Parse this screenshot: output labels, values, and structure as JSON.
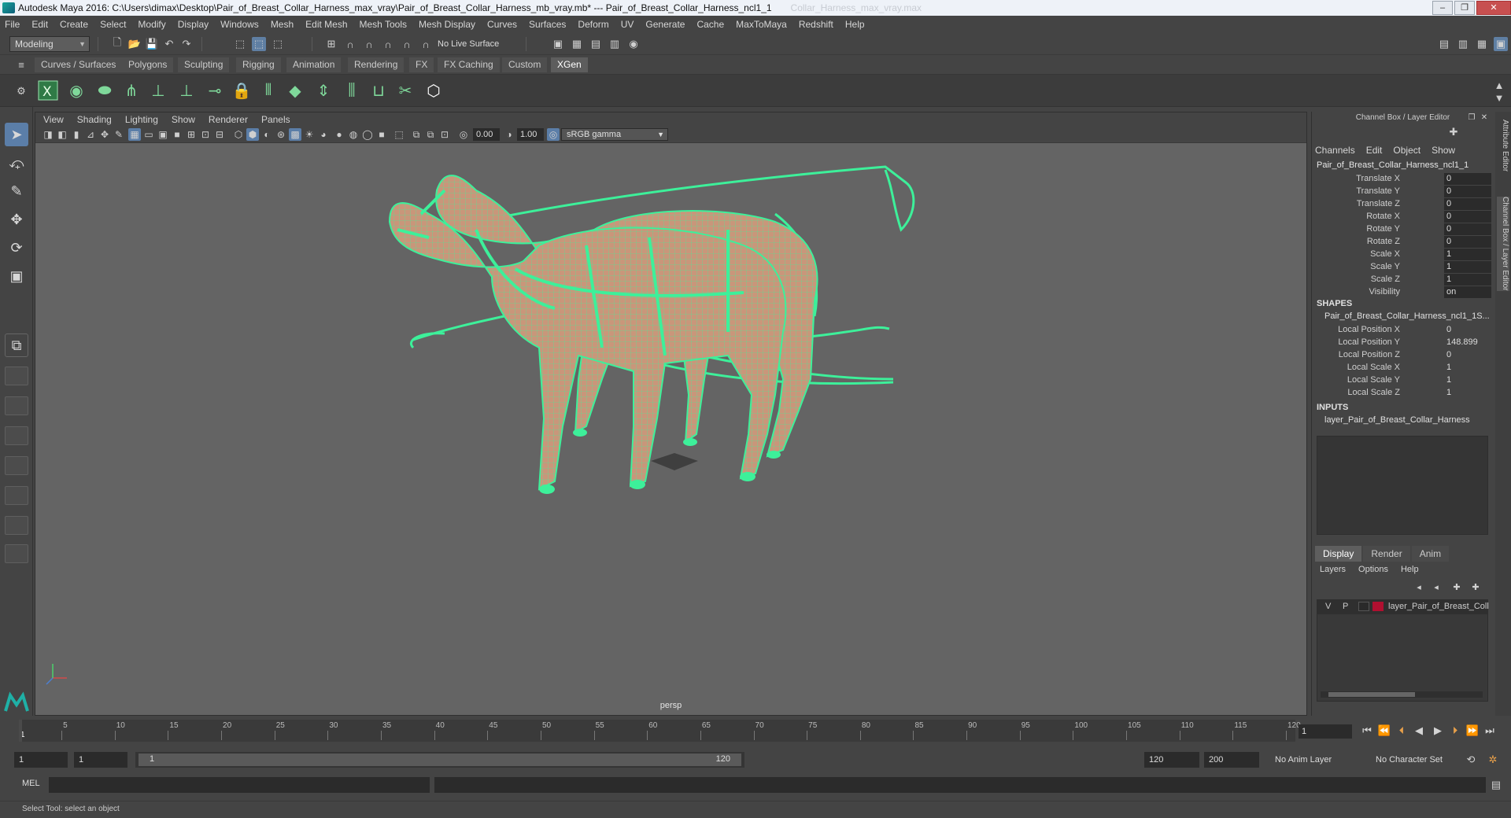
{
  "window": {
    "title": "Autodesk Maya 2016: C:\\Users\\dimax\\Desktop\\Pair_of_Breast_Collar_Harness_max_vray\\Pair_of_Breast_Collar_Harness_mb_vray.mb*   ---   Pair_of_Breast_Collar_Harness_ncl1_1",
    "ghost_text": "Collar_Harness_max_vray.max"
  },
  "menubar": [
    "File",
    "Edit",
    "Create",
    "Select",
    "Modify",
    "Display",
    "Windows",
    "Mesh",
    "Edit Mesh",
    "Mesh Tools",
    "Mesh Display",
    "Curves",
    "Surfaces",
    "Deform",
    "UV",
    "Generate",
    "Cache",
    "MaxToMaya",
    "Redshift",
    "Help"
  ],
  "statusline": {
    "mode": "Modeling",
    "live_surface": "No Live Surface"
  },
  "shelf": {
    "tabs": [
      "Curves / Surfaces",
      "Polygons",
      "Sculpting",
      "Rigging",
      "Animation",
      "Rendering",
      "FX",
      "FX Caching",
      "Custom",
      "XGen"
    ],
    "active_tab": "XGen"
  },
  "viewport": {
    "menu": [
      "View",
      "Shading",
      "Lighting",
      "Show",
      "Renderer",
      "Panels"
    ],
    "near_value": "0.00",
    "far_value": "1.00",
    "color_space": "sRGB gamma",
    "camera_label": "persp"
  },
  "channel_box": {
    "panel_title": "Channel Box / Layer Editor",
    "menu": [
      "Channels",
      "Edit",
      "Object",
      "Show"
    ],
    "object_name": "Pair_of_Breast_Collar_Harness_ncl1_1",
    "channels": [
      {
        "label": "Translate X",
        "value": "0"
      },
      {
        "label": "Translate Y",
        "value": "0"
      },
      {
        "label": "Translate Z",
        "value": "0"
      },
      {
        "label": "Rotate X",
        "value": "0"
      },
      {
        "label": "Rotate Y",
        "value": "0"
      },
      {
        "label": "Rotate Z",
        "value": "0"
      },
      {
        "label": "Scale X",
        "value": "1"
      },
      {
        "label": "Scale Y",
        "value": "1"
      },
      {
        "label": "Scale Z",
        "value": "1"
      },
      {
        "label": "Visibility",
        "value": "on"
      }
    ],
    "shapes_header": "SHAPES",
    "shape_name": "Pair_of_Breast_Collar_Harness_ncl1_1S...",
    "shape_channels": [
      {
        "label": "Local Position X",
        "value": "0"
      },
      {
        "label": "Local Position Y",
        "value": "148.899"
      },
      {
        "label": "Local Position Z",
        "value": "0"
      },
      {
        "label": "Local Scale X",
        "value": "1"
      },
      {
        "label": "Local Scale Y",
        "value": "1"
      },
      {
        "label": "Local Scale Z",
        "value": "1"
      }
    ],
    "inputs_header": "INPUTS",
    "input_name": "layer_Pair_of_Breast_Collar_Harness"
  },
  "layer_editor": {
    "tabs": [
      "Display",
      "Render",
      "Anim"
    ],
    "active_tab": "Display",
    "menu": [
      "Layers",
      "Options",
      "Help"
    ],
    "layer": {
      "v": "V",
      "p": "P",
      "name": "layer_Pair_of_Breast_Coll",
      "color": "#b01030"
    }
  },
  "side_tabs": [
    "Attribute Editor",
    "Channel Box / Layer Editor"
  ],
  "timeline": {
    "ticks": [
      "1",
      "5",
      "10",
      "15",
      "20",
      "25",
      "30",
      "35",
      "40",
      "45",
      "50",
      "55",
      "60",
      "65",
      "70",
      "75",
      "80",
      "85",
      "90",
      "95",
      "100",
      "105",
      "110",
      "115",
      "120"
    ],
    "current_frame": "1"
  },
  "range": {
    "start": "1",
    "playback_start": "1",
    "slider_start": "1",
    "slider_end": "120",
    "playback_end": "120",
    "end": "200",
    "anim_layer": "No Anim Layer",
    "character_set": "No Character Set"
  },
  "command_line": {
    "label": "MEL"
  },
  "help_line": "Select Tool: select an object",
  "colors": {
    "wire": "#3df09a",
    "horse": "#c9967a",
    "accent": "#5b7ea8"
  }
}
